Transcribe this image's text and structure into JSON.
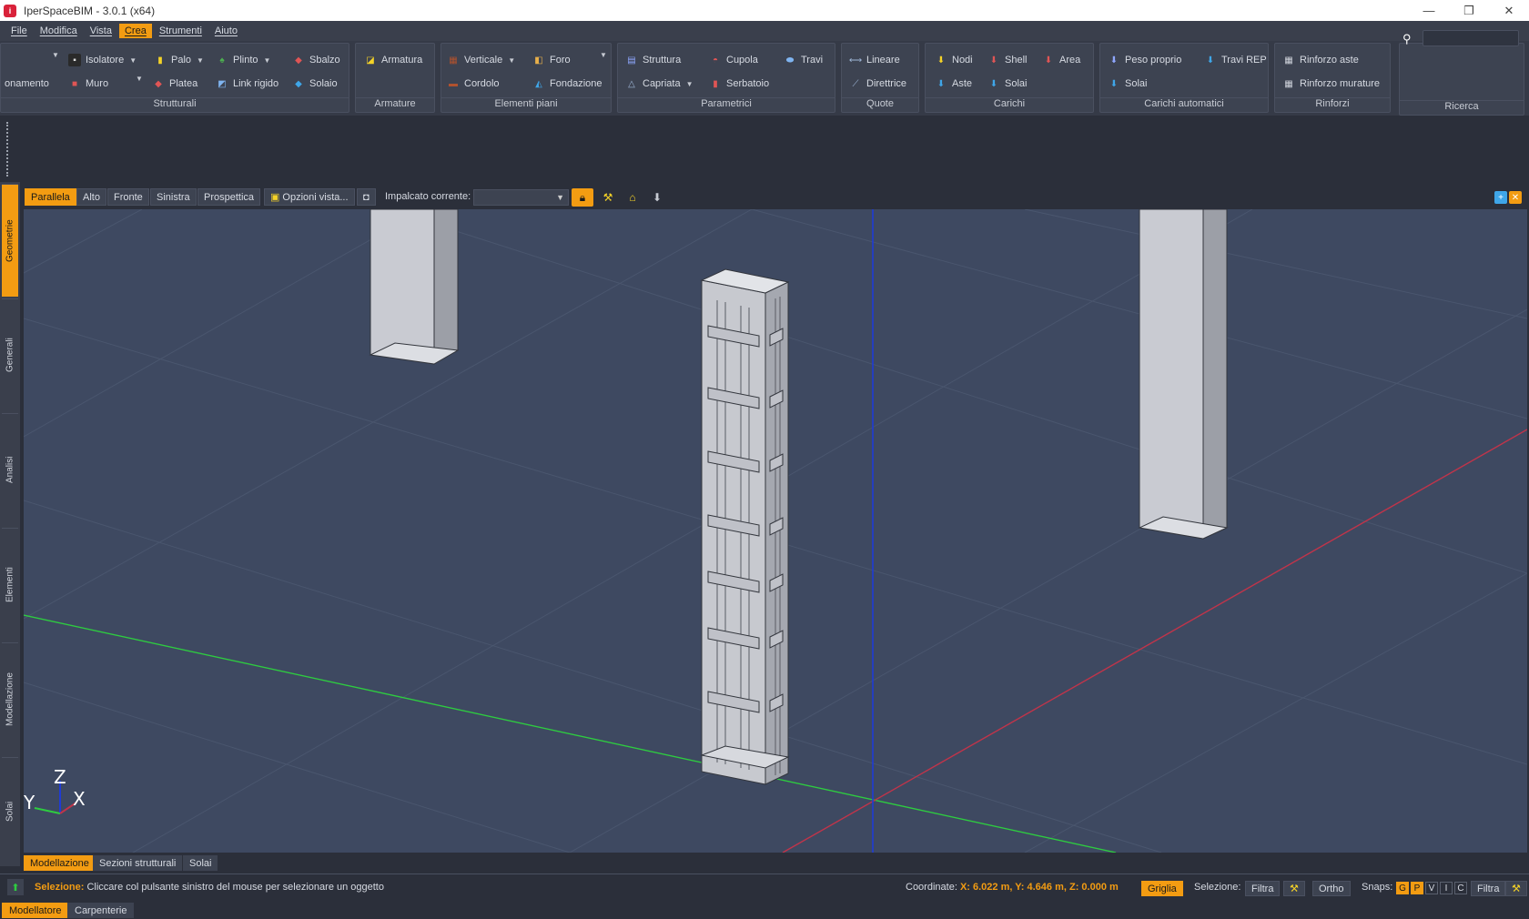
{
  "window": {
    "title": "IperSpaceBIM - 3.0.1 (x64)",
    "controls": [
      "—",
      "❐",
      "✕"
    ]
  },
  "menu": [
    "File",
    "Modifica",
    "Vista",
    "Crea",
    "Strumenti",
    "Aiuto"
  ],
  "menu_active": "Crea",
  "ribbon": {
    "strutturali": {
      "title": "Strutturali",
      "items": [
        "onamento",
        "Isolatore",
        "Palo",
        "Plinto",
        "Sbalzo",
        "Muro",
        "Platea",
        "Link rigido",
        "Solaio"
      ]
    },
    "armature": {
      "title": "Armature",
      "items": [
        "Armatura"
      ]
    },
    "elementi_piani": {
      "title": "Elementi piani",
      "items": [
        "Verticale",
        "Foro",
        "Cordolo",
        "Fondazione"
      ]
    },
    "parametrici": {
      "title": "Parametrici",
      "items": [
        "Struttura",
        "Cupola",
        "Travi",
        "Capriata",
        "Serbatoio"
      ]
    },
    "quote": {
      "title": "Quote",
      "items": [
        "Lineare",
        "Direttrice"
      ]
    },
    "carichi": {
      "title": "Carichi",
      "items": [
        "Nodi",
        "Shell",
        "Area",
        "Aste",
        "Solai"
      ]
    },
    "carichi_automatici": {
      "title": "Carichi automatici",
      "items": [
        "Peso proprio",
        "Travi REP",
        "Solai"
      ]
    },
    "rinforzi": {
      "title": "Rinforzi",
      "items": [
        "Rinforzo aste",
        "Rinforzo murature"
      ]
    },
    "ricerca": {
      "title": "Ricerca",
      "placeholder": ""
    }
  },
  "left_tabs": [
    "Geometrie",
    "Generali",
    "Analisi",
    "Elementi",
    "Modellazione",
    "Solai"
  ],
  "left_tab_active": "Geometrie",
  "view_toolbar": {
    "views": [
      "Parallela",
      "Alto",
      "Fronte",
      "Sinistra",
      "Prospettica"
    ],
    "active_view": "Parallela",
    "options_label": "Opzioni vista...",
    "impalcato_label": "Impalcato corrente:",
    "impalcato_value": ""
  },
  "axes": {
    "z": "Z",
    "y": "Y",
    "x": "X"
  },
  "bottom_tabs": [
    "Modellazione",
    "Sezioni strutturali",
    "Solai"
  ],
  "bottom_tab_active": "Modellazione",
  "status": {
    "selection_label": "Selezione:",
    "selection_hint": "Cliccare col pulsante sinistro del mouse per selezionare un oggetto",
    "coord_label": "Coordinate:",
    "coord_value": "X: 6.022 m, Y: 4.646 m, Z: 0.000 m",
    "griglia": "Griglia",
    "selezione2": "Selezione:",
    "filtra": "Filtra",
    "ortho": "Ortho",
    "snaps_label": "Snaps:",
    "snaps": [
      "G",
      "P",
      "V",
      "I",
      "C"
    ],
    "snaps_on": [
      "G",
      "P"
    ],
    "filtra2": "Filtra"
  },
  "footer_tabs": [
    "Modellatore",
    "Carpenterie"
  ],
  "footer_tab_active": "Modellatore",
  "colors": {
    "accent": "#f39c12",
    "viewport_bg": "#3e4961",
    "axis_x": "#c0344a",
    "axis_y": "#2ecc40",
    "axis_z": "#1f3bd6"
  }
}
